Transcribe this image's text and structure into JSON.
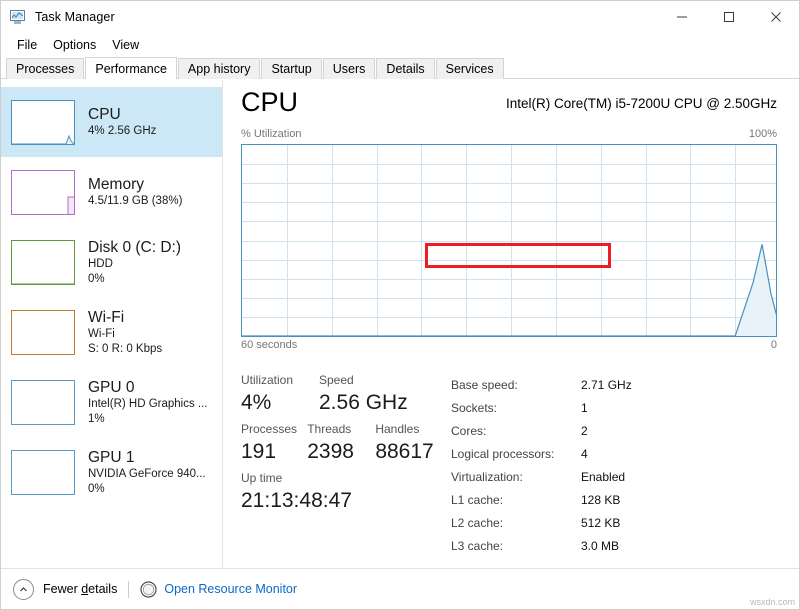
{
  "window": {
    "title": "Task Manager",
    "icon": "task-manager-icon",
    "controls": {
      "minimize": "–",
      "maximize": "□",
      "close": "✕"
    }
  },
  "menu": {
    "items": [
      "File",
      "Options",
      "View"
    ]
  },
  "tabs": {
    "items": [
      "Processes",
      "Performance",
      "App history",
      "Startup",
      "Users",
      "Details",
      "Services"
    ],
    "active": "Performance"
  },
  "sidebar": {
    "items": [
      {
        "title": "CPU",
        "sub1": "4%  2.56 GHz",
        "sub2": "",
        "color": "#4a8fbd",
        "selected": true
      },
      {
        "title": "Memory",
        "sub1": "4.5/11.9 GB (38%)",
        "sub2": "",
        "color": "#b06fc4",
        "selected": false
      },
      {
        "title": "Disk 0 (C: D:)",
        "sub1": "HDD",
        "sub2": "0%",
        "color": "#5d9b3e",
        "selected": false
      },
      {
        "title": "Wi-Fi",
        "sub1": "Wi-Fi",
        "sub2": "S: 0 R: 0 Kbps",
        "color": "#c07a2e",
        "selected": false
      },
      {
        "title": "GPU 0",
        "sub1": "Intel(R) HD Graphics ...",
        "sub2": "1%",
        "color": "#5a9bc8",
        "selected": false
      },
      {
        "title": "GPU 1",
        "sub1": "NVIDIA GeForce 940...",
        "sub2": "0%",
        "color": "#5a9bc8",
        "selected": false
      }
    ]
  },
  "main": {
    "title": "CPU",
    "model": "Intel(R) Core(TM) i5-7200U CPU @ 2.50GHz",
    "graph_label_left": "% Utilization",
    "graph_label_right": "100%",
    "graph_foot_left": "60 seconds",
    "graph_foot_right": "0"
  },
  "chart_data": {
    "type": "area",
    "title": "% Utilization",
    "xlabel": "60 seconds",
    "ylabel": "% Utilization",
    "ylim": [
      0,
      100
    ],
    "xlim": [
      60,
      0
    ],
    "grid": true,
    "accent_color": "#4a8fbd",
    "fill_color": "#e8f2f9",
    "x": [
      60,
      55,
      50,
      45,
      40,
      35,
      30,
      25,
      20,
      15,
      10,
      8,
      6,
      5,
      4,
      3,
      2,
      1,
      0
    ],
    "values": [
      0,
      0,
      0,
      0,
      0,
      0,
      0,
      0,
      0,
      0,
      0,
      0,
      0,
      0,
      14,
      28,
      48,
      22,
      4
    ]
  },
  "stats": {
    "left": [
      [
        {
          "label": "Utilization",
          "value": "4%"
        },
        {
          "label": "Speed",
          "value": "2.56 GHz"
        }
      ],
      [
        {
          "label": "Processes",
          "value": "191"
        },
        {
          "label": "Threads",
          "value": "2398"
        },
        {
          "label": "Handles",
          "value": "88617"
        }
      ],
      [
        {
          "label": "Up time",
          "value": "21:13:48:47"
        }
      ]
    ],
    "specs": [
      {
        "key": "Base speed:",
        "value": "2.71 GHz",
        "highlight": false
      },
      {
        "key": "Sockets:",
        "value": "1",
        "highlight": false
      },
      {
        "key": "Cores:",
        "value": "2",
        "highlight": false
      },
      {
        "key": "Logical processors:",
        "value": "4",
        "highlight": false
      },
      {
        "key": "Virtualization:",
        "value": "Enabled",
        "highlight": true
      },
      {
        "key": "L1 cache:",
        "value": "128 KB",
        "highlight": false
      },
      {
        "key": "L2 cache:",
        "value": "512 KB",
        "highlight": false
      },
      {
        "key": "L3 cache:",
        "value": "3.0 MB",
        "highlight": false
      }
    ],
    "highlight_color": "#ee1c25"
  },
  "footer": {
    "fewer_details_pre": "Fewer ",
    "fewer_details_underline": "d",
    "fewer_details_post": "etails",
    "resource_monitor": "Open Resource Monitor",
    "link_color": "#0b69c7"
  },
  "watermark": "wsxdn.com"
}
